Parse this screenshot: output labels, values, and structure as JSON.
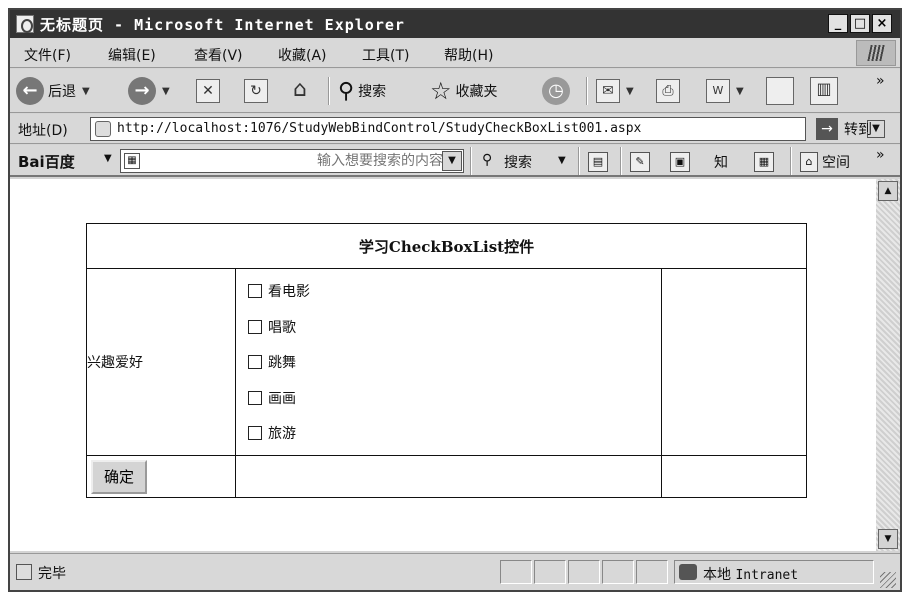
{
  "window": {
    "title": "无标题页 - Microsoft Internet Explorer",
    "controls": {
      "minimize": "_",
      "maximize": "□",
      "close": "×"
    }
  },
  "menubar": {
    "items": [
      "文件(F)",
      "编辑(E)",
      "查看(V)",
      "收藏(A)",
      "工具(T)",
      "帮助(H)"
    ]
  },
  "toolbar": {
    "back_label": "后退",
    "search_label": "搜索",
    "favorites_label": "收藏夹",
    "overflow": "»"
  },
  "addressbar": {
    "label": "地址(D)",
    "url": "http://localhost:1076/StudyWebBindControl/StudyCheckBoxList001.aspx",
    "go_label": "转到"
  },
  "baidubar": {
    "logo": "Bai百度",
    "search_placeholder": "输入想要搜索的内容",
    "search_label": "搜索",
    "space_label": "空间",
    "know_label": "知",
    "overflow": "»"
  },
  "page": {
    "table_title": "学习CheckBoxList控件",
    "row_label": "兴趣爱好",
    "checkbox_options": [
      {
        "label": "看电影",
        "checked": false
      },
      {
        "label": "唱歌",
        "checked": false
      },
      {
        "label": "跳舞",
        "checked": false
      },
      {
        "label": "画画",
        "checked": false
      },
      {
        "label": "旅游",
        "checked": false
      }
    ],
    "submit_label": "确定"
  },
  "statusbar": {
    "status_text": "完毕",
    "zone_prefix": "本地",
    "zone_name": "Intranet"
  },
  "icons": {
    "back": "arrow-left-icon",
    "forward": "arrow-right-icon",
    "stop": "stop-icon",
    "refresh": "refresh-icon",
    "home": "home-icon",
    "search": "magnifier-icon",
    "favorites": "star-icon",
    "history": "history-icon",
    "mail": "mail-icon",
    "print": "printer-icon",
    "edit": "word-icon"
  }
}
